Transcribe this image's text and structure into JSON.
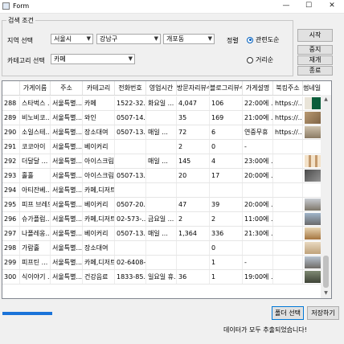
{
  "window": {
    "title": "Form",
    "minimize": "—",
    "maximize": "☐",
    "close": "✕"
  },
  "search": {
    "group_label": "검색 조건",
    "region_label": "지역 선택",
    "city": "서울시",
    "district": "강남구",
    "dong": "개포동",
    "category_label": "카테고리 선택",
    "category": "카페",
    "sort_label": "정렬",
    "sort_options": [
      {
        "label": "관련도순",
        "selected": true
      },
      {
        "label": "거리순",
        "selected": false
      }
    ]
  },
  "buttons": {
    "start": "시작",
    "stop": "중지",
    "resume": "재개",
    "exit": "종료",
    "select_folder": "폴더 선택",
    "save": "저장하기"
  },
  "table": {
    "columns": [
      "",
      "가게이름",
      "주소",
      "카테고리",
      "전화번호",
      "영업시간",
      "방문자리뷰수",
      "블로그리뷰수",
      "가게설명",
      "북킹주소",
      "썸네일"
    ],
    "rows": [
      {
        "no": "288",
        "name": "스타벅스 ...",
        "addr": "서울특별...",
        "cat": "카페",
        "phone": "1522-32...",
        "hours": "화요일 ...",
        "visit": "4,047",
        "blog": "106",
        "desc": "22:00에 ...",
        "booking": "https://...",
        "thumb": "starbucks"
      },
      {
        "no": "289",
        "name": "비노비코...",
        "addr": "서울특별...",
        "cat": "와인",
        "phone": "0507-14...",
        "hours": "",
        "visit": "35",
        "blog": "169",
        "desc": "21:00에 ...",
        "booking": "https://...",
        "thumb": "interior"
      },
      {
        "no": "290",
        "name": "소일스테...",
        "addr": "서울특별...",
        "cat": "장소대여",
        "phone": "0507-13...",
        "hours": "매일 ...",
        "visit": "72",
        "blog": "6",
        "desc": "연중무휴",
        "booking": "https://...",
        "thumb": "room"
      },
      {
        "no": "291",
        "name": "코코아이",
        "addr": "서울특별...",
        "cat": "베이커리",
        "phone": "",
        "hours": "",
        "visit": "2",
        "blog": "0",
        "desc": "-",
        "booking": "",
        "thumb": ""
      },
      {
        "no": "292",
        "name": "더달달 ...",
        "addr": "서울특별...",
        "cat": "아이스크림",
        "phone": "",
        "hours": "매일 ...",
        "visit": "145",
        "blog": "4",
        "desc": "23:00에 ...",
        "booking": "",
        "thumb": "dessert"
      },
      {
        "no": "293",
        "name": "홀홀",
        "addr": "서울특별...",
        "cat": "아이스크림",
        "phone": "0507-13...",
        "hours": "",
        "visit": "20",
        "blog": "17",
        "desc": "20:00에 ...",
        "booking": "",
        "thumb": "icecream"
      },
      {
        "no": "294",
        "name": "아티잔베...",
        "addr": "서울특별...",
        "cat": "카페,디저트",
        "phone": "",
        "hours": "",
        "visit": "",
        "blog": "",
        "desc": "",
        "booking": "",
        "thumb": ""
      },
      {
        "no": "295",
        "name": "피프 브레드",
        "addr": "서울특별...",
        "cat": "베이커리",
        "phone": "0507-20...",
        "hours": "",
        "visit": "47",
        "blog": "39",
        "desc": "20:00에 ...",
        "booking": "",
        "thumb": "bread"
      },
      {
        "no": "296",
        "name": "슈가플럼...",
        "addr": "서울특별...",
        "cat": "카페,디저트",
        "phone": "02-573-...",
        "hours": "금요일 ...",
        "visit": "2",
        "blog": "2",
        "desc": "11:00에 ...",
        "booking": "",
        "thumb": "cafe"
      },
      {
        "no": "297",
        "name": "나폴레옹...",
        "addr": "서울특별...",
        "cat": "베이커리",
        "phone": "0507-13...",
        "hours": "매일 ...",
        "visit": "1,364",
        "blog": "336",
        "desc": "21:30에 ...",
        "booking": "",
        "thumb": "showcase"
      },
      {
        "no": "298",
        "name": "가람홀",
        "addr": "서울특별...",
        "cat": "장소대여",
        "phone": "",
        "hours": "",
        "visit": "",
        "blog": "0",
        "desc": "",
        "booking": "",
        "thumb": "hall"
      },
      {
        "no": "299",
        "name": "피프틴 ...",
        "addr": "서울특별...",
        "cat": "카페,디저트",
        "phone": "02-6408-...",
        "hours": "",
        "visit": "",
        "blog": "1",
        "desc": "-",
        "booking": "",
        "thumb": "street"
      },
      {
        "no": "300",
        "name": "식이야기 ...",
        "addr": "서울특별...",
        "cat": "건강음료",
        "phone": "1833-85...",
        "hours": "일요일 휴...",
        "visit": "36",
        "blog": "1",
        "desc": "19:00에 ...",
        "booking": "",
        "thumb": "shop"
      }
    ]
  },
  "progress": {
    "percent": 15
  },
  "status": "데이터가 모두 추출되었습니다!",
  "icons": {
    "app": "form-icon",
    "dropdown": "chevron-down-icon"
  },
  "colors": {
    "accent": "#1a73d9",
    "radio_selected": "#0060c0"
  }
}
